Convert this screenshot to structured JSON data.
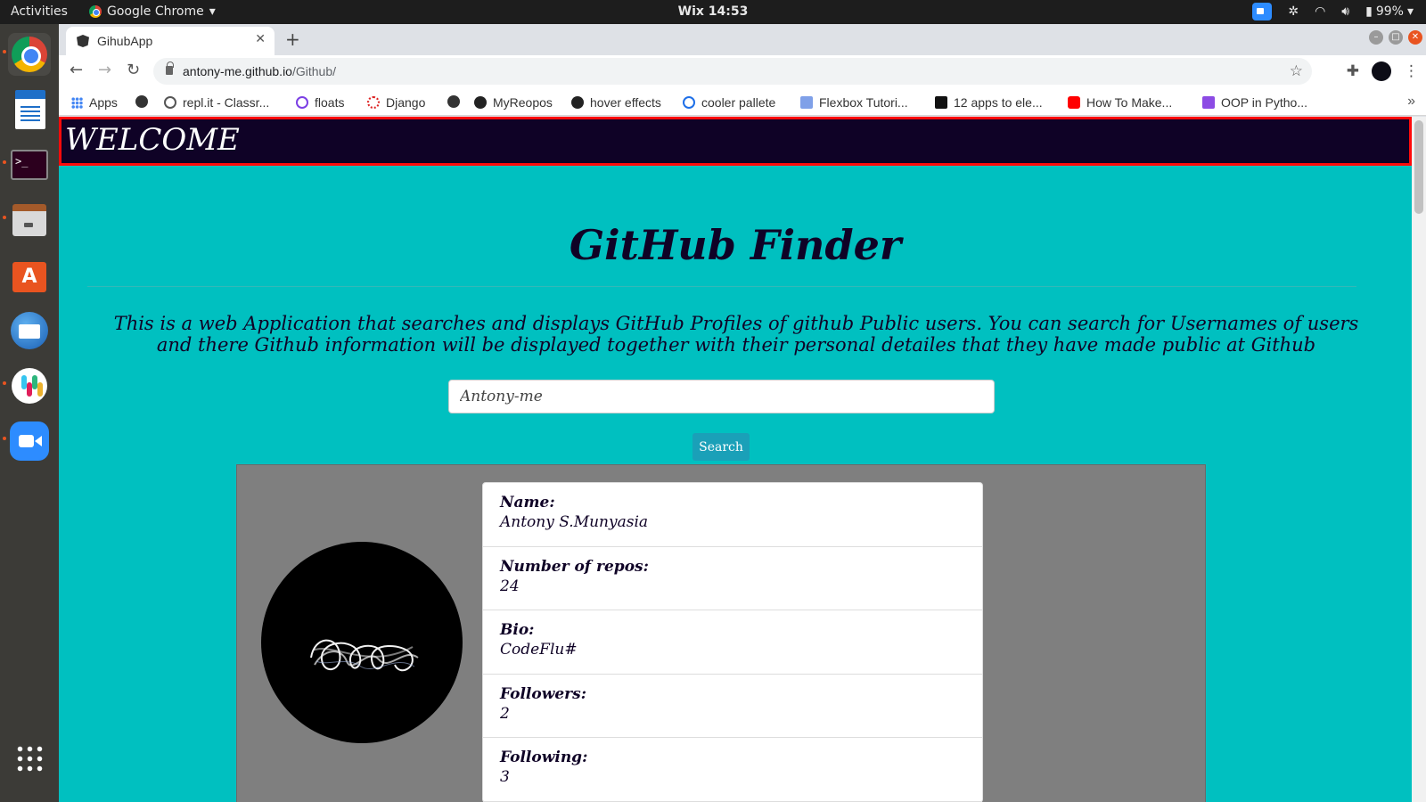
{
  "os": {
    "activities": "Activities",
    "app_menu": "Google Chrome",
    "clock": "Wix 14:53",
    "battery": "99%"
  },
  "browser": {
    "tab_title": "GihubApp",
    "url_host": "antony-me.github.io",
    "url_path": "/Github/",
    "bookmarks": [
      {
        "label": "Apps",
        "icon": "apps-grid-icon"
      },
      {
        "label": "",
        "icon": "globe-icon"
      },
      {
        "label": "repl.it - Classr...",
        "icon": "replit-icon"
      },
      {
        "label": "floats",
        "icon": "floats-icon"
      },
      {
        "label": "Django",
        "icon": "django-icon"
      },
      {
        "label": "",
        "icon": "globe-icon"
      },
      {
        "label": "MyReopos",
        "icon": "github-icon"
      },
      {
        "label": "hover effects",
        "icon": "github-icon"
      },
      {
        "label": "cooler pallete",
        "icon": "coolors-icon"
      },
      {
        "label": "Flexbox Tutori...",
        "icon": "flexbox-icon"
      },
      {
        "label": "12 apps to ele...",
        "icon": "app-icon"
      },
      {
        "label": "How To Make...",
        "icon": "youtube-icon"
      },
      {
        "label": "OOP in Pytho...",
        "icon": "doc-icon"
      }
    ]
  },
  "page": {
    "banner": "WELCOME",
    "title": "GitHub Finder",
    "description": "This is a web Application that searches and displays GitHub Profiles of github Public users. You can search for Usernames of users and there Github information will be displayed together with their personal detailes that they have made public at Github",
    "search": {
      "value": "Antony-me",
      "button": "Search"
    },
    "profile": {
      "fields": [
        {
          "label": "Name:",
          "value": "Antony S.Munyasia"
        },
        {
          "label": "Number of repos:",
          "value": "24"
        },
        {
          "label": "Bio:",
          "value": "CodeFlu#"
        },
        {
          "label": "Followers:",
          "value": "2"
        },
        {
          "label": "Following:",
          "value": "3"
        }
      ]
    }
  },
  "colors": {
    "page_bg": "#00c0c0",
    "banner_bg": "#0f0226",
    "banner_border": "#ff0a0a",
    "panel_bg": "#7f7f7f",
    "button_bg": "#1aa0b8"
  }
}
